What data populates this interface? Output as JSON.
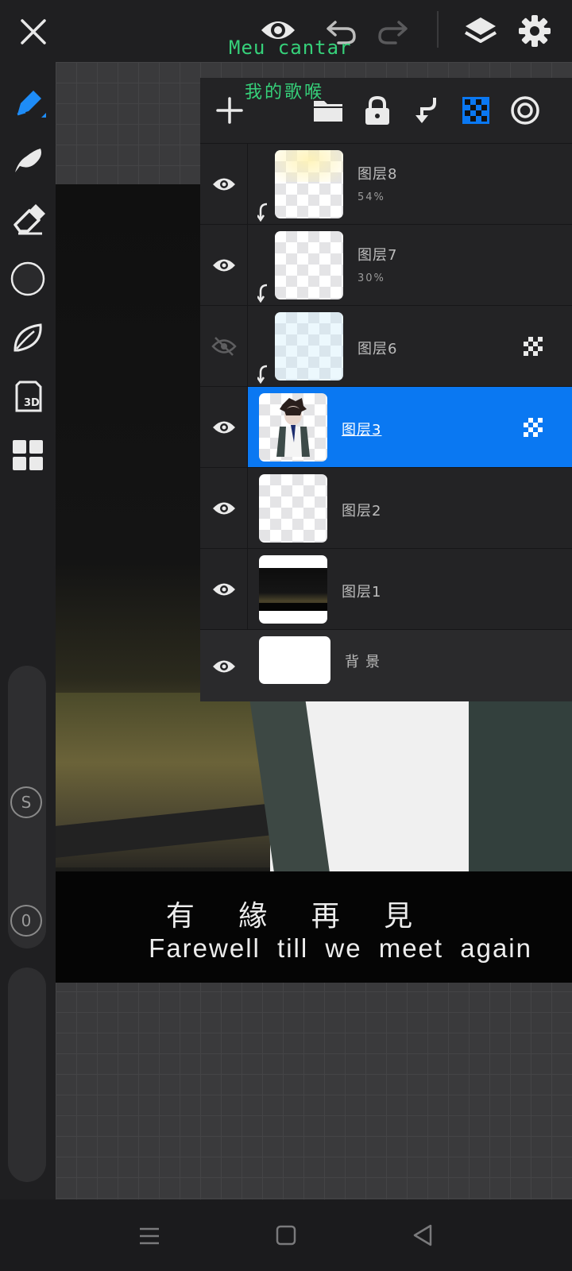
{
  "app": {
    "overlay_text_top": "Meu cantar",
    "overlay_text_cn": "我的歌喉"
  },
  "topbar": {
    "close_icon": "close-icon",
    "eye_icon": "eye-icon",
    "undo_icon": "undo-icon",
    "redo_icon": "redo-icon",
    "layers_icon": "layers-icon",
    "settings_icon": "gear-icon"
  },
  "canvas": {
    "subtitle_cn": "有 緣 再 見",
    "subtitle_en": "Farewell till we meet again"
  },
  "left_toolbar": {
    "tools": [
      "pen-icon",
      "smudge-icon",
      "eraser-icon",
      "color-circle-icon",
      "leaf-icon",
      "3d-icon",
      "grid-icon"
    ],
    "size_label": "S",
    "opacity_label": "0"
  },
  "layer_panel": {
    "toolbar": [
      "add-layer-icon",
      "folder-icon",
      "lock-icon",
      "clip-icon",
      "checker-icon",
      "target-icon"
    ],
    "layers": [
      {
        "name": "图层8",
        "opacity": "54%",
        "visible": true,
        "clipped": true
      },
      {
        "name": "图层7",
        "opacity": "30%",
        "visible": true,
        "clipped": true
      },
      {
        "name": "图层6",
        "opacity": "",
        "visible": false,
        "clipped": true
      },
      {
        "name": "图层3",
        "opacity": "",
        "visible": true,
        "selected": true
      },
      {
        "name": "图层2",
        "opacity": "",
        "visible": true
      },
      {
        "name": "图层1",
        "opacity": "",
        "visible": true
      },
      {
        "name": "背景",
        "opacity": "",
        "visible": true
      }
    ]
  },
  "colors": {
    "accent": "#0a78f2",
    "overlay_green": "#36d17a"
  },
  "navbar": {
    "menu_icon": "menu-icon",
    "home_icon": "home-square-icon",
    "back_icon": "back-triangle-icon"
  }
}
